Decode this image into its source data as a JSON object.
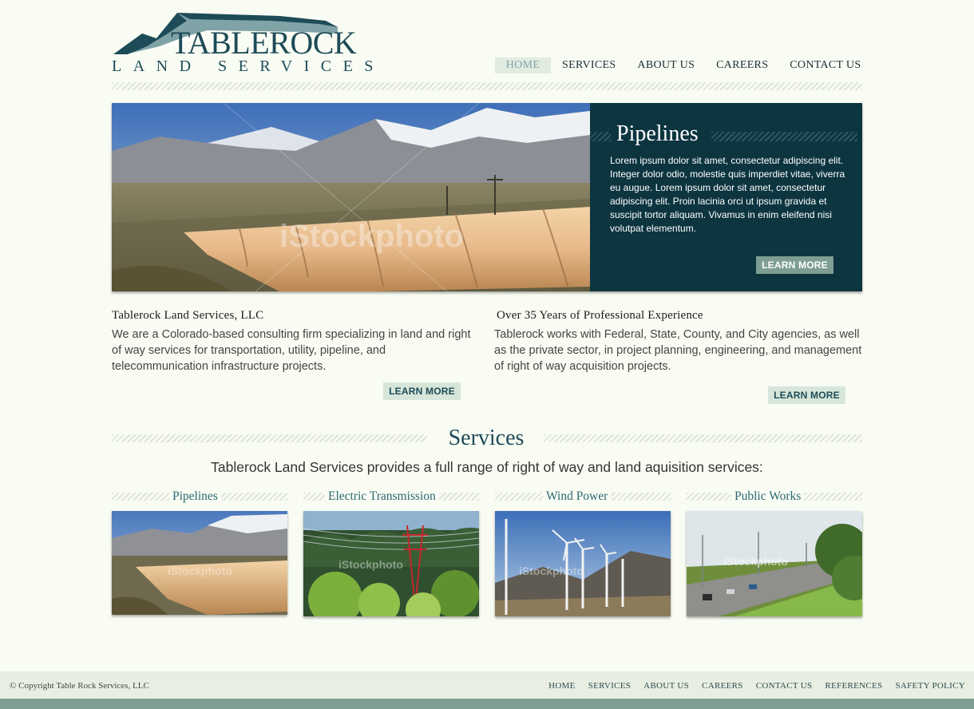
{
  "brand": {
    "logo_top": "TABLEROCK",
    "logo_bottom": "LAND SERVICES"
  },
  "nav": {
    "items": [
      "HOME",
      "SERVICES",
      "ABOUT US",
      "CAREERS",
      "CONTACT US"
    ],
    "active": "HOME"
  },
  "hero": {
    "title": "Pipelines",
    "text": "Lorem ipsum dolor sit amet, consectetur adipiscing elit. Integer dolor odio, molestie quis imperdiet vitae, viverra eu augue. Lorem ipsum dolor sit amet, consectetur adipiscing elit. Proin lacinia orci ut ipsum gravida et suscipit tortor aliquam. Vivamus in enim eleifend nisi volutpat elementum.",
    "button": "LEARN MORE",
    "watermark": "iStockphoto"
  },
  "intro": {
    "left": {
      "title": "Tablerock Land Services, LLC",
      "text": "We are a Colorado-based consulting firm specializing in land and right of way services for transportation, utility, pipeline, and telecommunication infrastructure projects.",
      "button": "LEARN MORE"
    },
    "right": {
      "title": "Over 35 Years of Professional Experience",
      "text": "Tablerock works with Federal, State, County, and City agencies, as well as the private sector, in project planning, engineering, and management of right of way acquisition projects.",
      "button": "LEARN MORE"
    }
  },
  "services": {
    "title": "Services",
    "subtitle": "Tablerock Land Services provides a full range of right of way and land aquisition services:",
    "cards": [
      {
        "label": "Pipelines",
        "watermark": "iStockphoto"
      },
      {
        "label": "Electric Transmission",
        "watermark": "iStockphoto"
      },
      {
        "label": "Wind Power",
        "watermark": "iStockphoto"
      },
      {
        "label": "Public Works",
        "watermark": "iStockphoto"
      }
    ]
  },
  "footer": {
    "copyright": "© Copyright Table Rock Services, LLC",
    "links": [
      "HOME",
      "SERVICES",
      "ABOUT US",
      "CAREERS",
      "CONTACT US",
      "REFERENCES",
      "SAFETY POLICY"
    ]
  },
  "colors": {
    "background": "#f9fcf3",
    "brand_dark": "#0c3540",
    "brand_teal": "#1d4b57",
    "button_sage": "#7e9e94",
    "button_light": "#d7e6da",
    "nav_active": "#e2ebe0",
    "footer": "#e8efe2"
  }
}
